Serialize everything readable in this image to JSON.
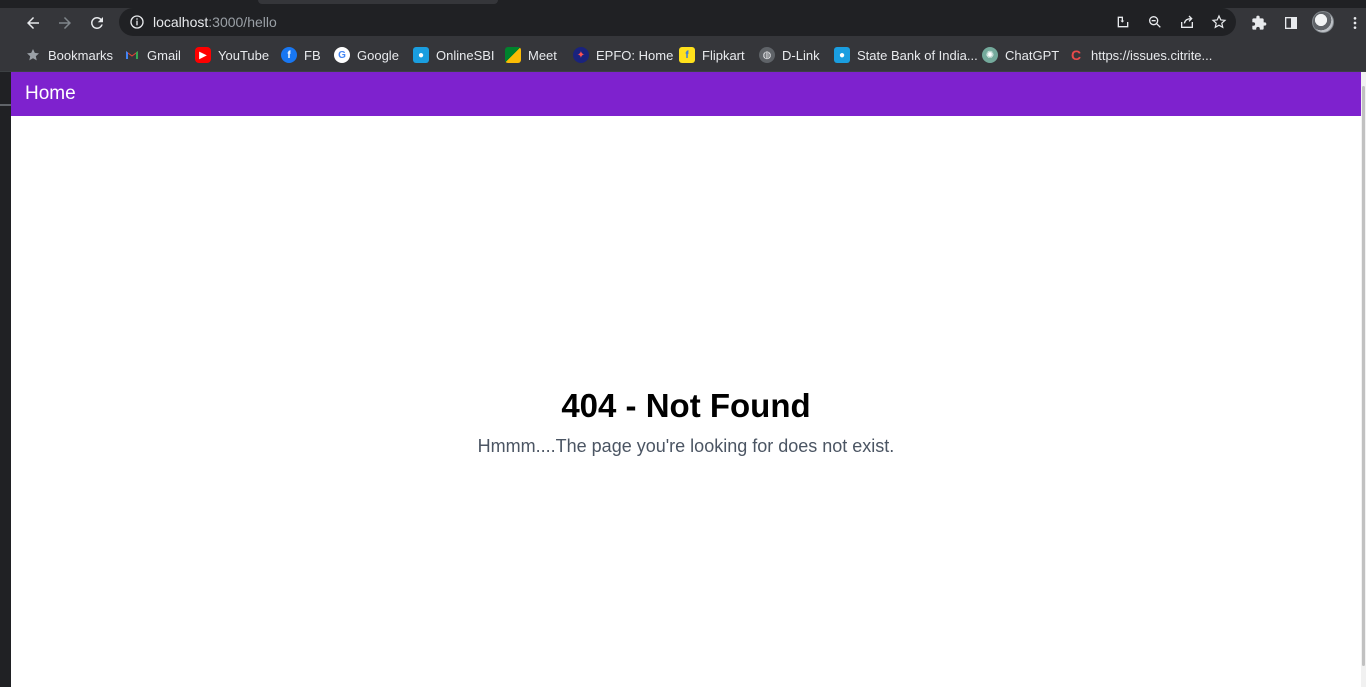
{
  "browser": {
    "url_host": "localhost",
    "url_rest": ":3000/hello",
    "bookmarks": [
      {
        "label": "Bookmarks",
        "icon": "star-icon"
      },
      {
        "label": "Gmail",
        "icon": "gmail-icon"
      },
      {
        "label": "YouTube",
        "icon": "youtube-icon"
      },
      {
        "label": "FB",
        "icon": "facebook-icon"
      },
      {
        "label": "Google",
        "icon": "google-icon"
      },
      {
        "label": "OnlineSBI",
        "icon": "sbi-icon"
      },
      {
        "label": "Meet",
        "icon": "meet-icon"
      },
      {
        "label": "EPFO: Home",
        "icon": "epfo-icon"
      },
      {
        "label": "Flipkart",
        "icon": "flipkart-icon"
      },
      {
        "label": "D-Link",
        "icon": "globe-icon"
      },
      {
        "label": "State Bank of India...",
        "icon": "sbi-icon"
      },
      {
        "label": "ChatGPT",
        "icon": "chatgpt-icon"
      },
      {
        "label": "https://issues.citrite...",
        "icon": "citrix-icon"
      }
    ]
  },
  "page": {
    "navbar": {
      "home_label": "Home",
      "color": "#7e22ce"
    },
    "error": {
      "title": "404 - Not Found",
      "message": "Hmmm....The page you're looking for does not exist."
    }
  }
}
